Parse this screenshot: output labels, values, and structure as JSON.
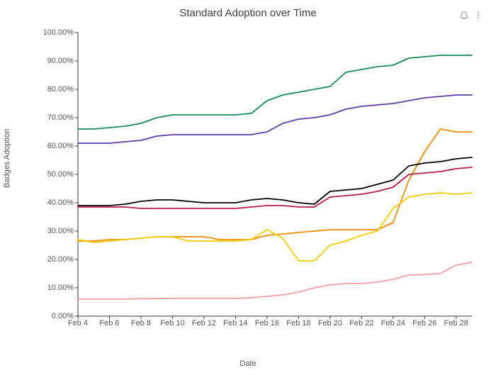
{
  "chart_data": {
    "type": "line",
    "title": "Standard Adoption over Time",
    "xlabel": "Date",
    "ylabel": "Badges Adoption",
    "ylim": [
      0,
      100
    ],
    "y_ticks": [
      0,
      10,
      20,
      30,
      40,
      50,
      60,
      70,
      80,
      90,
      100
    ],
    "y_tick_labels": [
      "0.00%",
      "10.00%",
      "20.00%",
      "30.00%",
      "40.00%",
      "50.00%",
      "60.00%",
      "70.00%",
      "80.00%",
      "90.00%",
      "100.00%"
    ],
    "categories": [
      "Feb 4",
      "Feb 5",
      "Feb 6",
      "Feb 7",
      "Feb 8",
      "Feb 9",
      "Feb 10",
      "Feb 11",
      "Feb 12",
      "Feb 13",
      "Feb 14",
      "Feb 15",
      "Feb 16",
      "Feb 17",
      "Feb 18",
      "Feb 19",
      "Feb 20",
      "Feb 21",
      "Feb 22",
      "Feb 23",
      "Feb 24",
      "Feb 25",
      "Feb 26",
      "Feb 27",
      "Feb 28",
      "Feb 29"
    ],
    "x_tick_labels": [
      "Feb 4",
      "Feb 6",
      "Feb 8",
      "Feb 10",
      "Feb 12",
      "Feb 14",
      "Feb 16",
      "Feb 18",
      "Feb 20",
      "Feb 22",
      "Feb 24",
      "Feb 26",
      "Feb 28"
    ],
    "x_tick_idx": [
      0,
      2,
      4,
      6,
      8,
      10,
      12,
      14,
      16,
      18,
      20,
      22,
      24
    ],
    "series": [
      {
        "name": "green",
        "color": "#188a5a",
        "values": [
          66,
          66,
          66.5,
          67,
          68,
          70,
          71,
          71,
          71,
          71,
          71,
          71.5,
          76,
          78,
          79,
          80,
          81,
          86,
          87,
          88,
          88.5,
          91,
          91.5,
          92,
          92,
          92
        ]
      },
      {
        "name": "purple",
        "color": "#5b3da8",
        "values": [
          61,
          61,
          61,
          61.5,
          62,
          63.5,
          64,
          64,
          64,
          64,
          64,
          64,
          65,
          68,
          69.5,
          70,
          71,
          73,
          74,
          74.5,
          75,
          76,
          77,
          77.5,
          78,
          78
        ]
      },
      {
        "name": "orange",
        "color": "#f58b00",
        "values": [
          26.5,
          26.5,
          27,
          27,
          27.5,
          28,
          28,
          28,
          28,
          27,
          27,
          27,
          28.5,
          29,
          29.5,
          30,
          30.5,
          30.5,
          30.5,
          30.5,
          33,
          48,
          58,
          66,
          65,
          65
        ]
      },
      {
        "name": "black",
        "color": "#000000",
        "values": [
          39,
          39,
          39,
          39.5,
          40.5,
          41,
          41,
          40.5,
          40,
          40,
          40,
          41,
          41.5,
          41,
          40,
          39.5,
          44,
          44.5,
          45,
          46.5,
          48,
          53,
          54,
          54.5,
          55.5,
          56
        ]
      },
      {
        "name": "crimson",
        "color": "#b71c4b",
        "values": [
          38.5,
          38.5,
          38.5,
          38.5,
          38,
          38,
          38,
          38,
          38,
          38,
          38,
          38.5,
          39,
          39,
          38.5,
          38.5,
          42,
          42.5,
          43,
          44,
          45.5,
          50,
          50.5,
          51,
          52,
          52.5
        ]
      },
      {
        "name": "yellow",
        "color": "#f6cc00",
        "values": [
          27,
          26,
          26.5,
          27,
          27.5,
          28,
          28,
          26.5,
          26.5,
          26.5,
          26.5,
          27,
          30.5,
          27.5,
          19.5,
          19.5,
          25,
          26.5,
          28.5,
          30,
          38,
          42,
          43,
          43.5,
          43,
          43.5
        ]
      },
      {
        "name": "lightpink",
        "color": "#f49fa8",
        "values": [
          6,
          6,
          6,
          6,
          6.2,
          6.2,
          6.3,
          6.3,
          6.3,
          6.3,
          6.3,
          6.5,
          7,
          7.5,
          8.5,
          10,
          11,
          11.5,
          11.5,
          12,
          13,
          14.5,
          14.7,
          15,
          18,
          19
        ]
      }
    ]
  },
  "icons": {
    "bell": "bell-icon",
    "menu": "menu-icon"
  }
}
